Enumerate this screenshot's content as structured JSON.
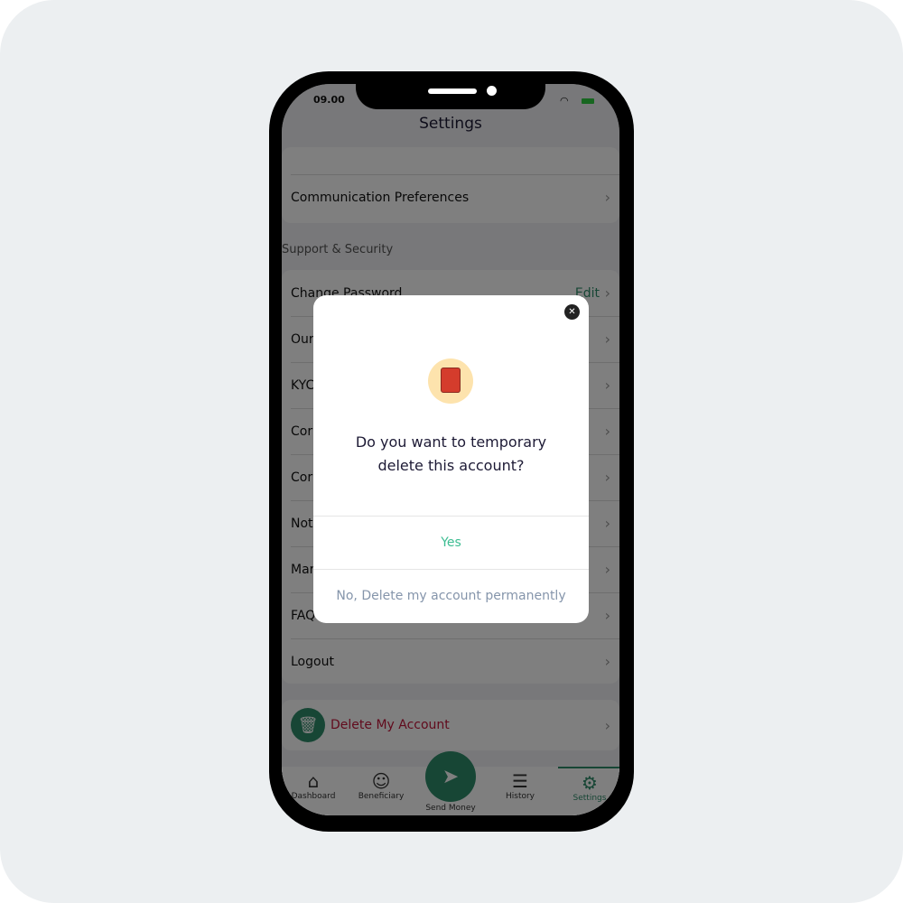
{
  "status": {
    "time": "09.00"
  },
  "header": {
    "title": "Settings"
  },
  "top_list": [
    {
      "label": "Communication Preferences"
    }
  ],
  "section_title": "Support & Security",
  "support_list": [
    {
      "label": "Change Password",
      "action": "Edit"
    },
    {
      "label": "Our"
    },
    {
      "label": "KYC"
    },
    {
      "label": "Cor"
    },
    {
      "label": "Cor"
    },
    {
      "label": "Not"
    },
    {
      "label": "Mar"
    },
    {
      "label": "FAQ"
    },
    {
      "label": "Logout"
    }
  ],
  "delete_account": {
    "label": "Delete My Account",
    "icon": "trash-icon"
  },
  "nav": {
    "items": [
      {
        "label": "Dashboard",
        "icon": "home-icon"
      },
      {
        "label": "Beneficiary",
        "icon": "users-icon"
      },
      {
        "label": "Send Money",
        "icon": "send-icon"
      },
      {
        "label": "History",
        "icon": "list-icon"
      },
      {
        "label": "Settings",
        "icon": "gear-icon",
        "active": true
      }
    ]
  },
  "modal": {
    "question": "Do you want to temporary delete this account?",
    "yes_label": "Yes",
    "no_label": "No, Delete my account permanently"
  },
  "colors": {
    "accent": "#2f8c6a",
    "danger": "#c3173a",
    "yes": "#3dbd92",
    "no": "#8595ab"
  }
}
